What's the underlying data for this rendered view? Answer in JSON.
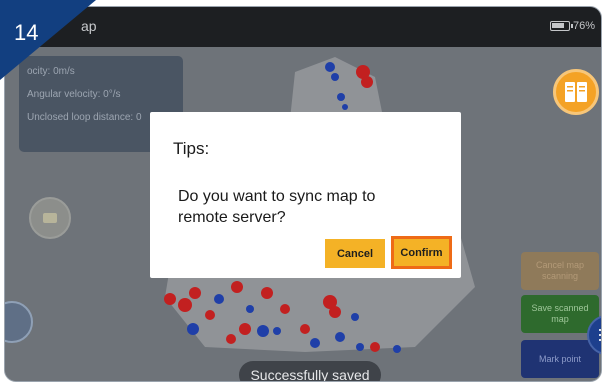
{
  "step": {
    "number": "14"
  },
  "topbar": {
    "title": "ap",
    "battery_percent": "76%"
  },
  "info_panel": {
    "velocity": "ocity: 0m/s",
    "angular_velocity": "Angular velocity: 0°/s",
    "unclosed_loop": "Unclosed loop distance: 0"
  },
  "dialog": {
    "title": "Tips:",
    "message": "Do you want to sync map to remote server?",
    "cancel_label": "Cancel",
    "confirm_label": "Confirm"
  },
  "side_buttons": {
    "cancel_scanning": "Cancel map scanning",
    "save_scanned": "Save scanned map",
    "mark_point": "Mark point"
  },
  "toast": {
    "text": "Successfully saved"
  },
  "icons": {
    "help": "book-icon",
    "locate": "locate-icon",
    "menu": "menu-icon",
    "battery": "battery-icon"
  },
  "colors": {
    "accent": "#f4b226",
    "confirm_border": "#ee6b17",
    "badge": "#123f80",
    "map_red": "#c22020",
    "map_blue": "#1f3fa8"
  }
}
